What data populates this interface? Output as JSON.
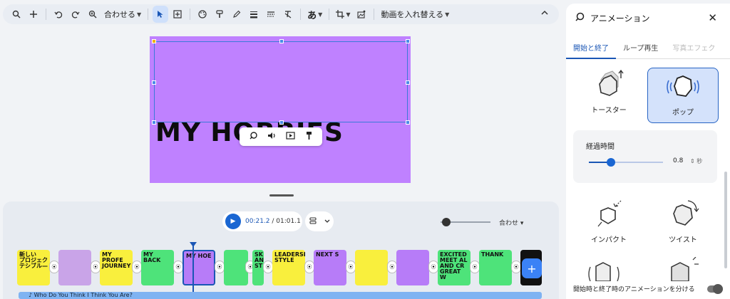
{
  "toolbar": {
    "fit_label": "合わせる",
    "font_glyph": "あ",
    "replace_video_label": "動画を入れ替える",
    "icons": [
      "search-icon",
      "plus-icon",
      "undo-icon",
      "redo-icon",
      "zoom-icon",
      "select-arrow-icon",
      "add-textbox-icon",
      "palette-icon",
      "paint-format-icon",
      "pen-icon",
      "line-weight-icon",
      "line-dash-icon",
      "clear-format-icon",
      "font-icon",
      "crop-icon",
      "image-options-icon",
      "chevron-up-icon"
    ]
  },
  "slide": {
    "title": "MY HOBBIES",
    "background": "#bf81ff"
  },
  "timeline": {
    "current_time": "00:21.2",
    "total_time": "01:01.1",
    "fit_label": "合わせ",
    "audio_track": "Who Do You Think I Think You Are?",
    "thumbnails": [
      {
        "text": "新しい\nプロジェク\nテシブル—",
        "bg": "#f9ef3d",
        "color": "#111"
      },
      {
        "text": "",
        "bg": "#c9a4e8",
        "color": "#111"
      },
      {
        "text": "MY PROFE\nJOURNEY",
        "bg": "#f9ef3d",
        "color": "#111"
      },
      {
        "text": "MY BACK",
        "bg": "#4ee37a",
        "color": "#111"
      },
      {
        "text": "MY HOE",
        "bg": "#b77cf8",
        "color": "#111"
      },
      {
        "text": "",
        "bg": "#4ee37a",
        "color": "#111"
      },
      {
        "text": "SK\nAN\nST",
        "bg": "#4ee37a",
        "color": "#111"
      },
      {
        "text": "LEADERSHIP\nSTYLE",
        "bg": "#f9ef3d",
        "color": "#111"
      },
      {
        "text": "NEXT S",
        "bg": "#b77cf8",
        "color": "#111"
      },
      {
        "text": "",
        "bg": "#f9ef3d",
        "color": "#111"
      },
      {
        "text": "",
        "bg": "#b77cf8",
        "color": "#111"
      },
      {
        "text": "EXCITED\nMEET AL\nAND CR\nGREAT W",
        "bg": "#4ee37a",
        "color": "#111"
      },
      {
        "text": "THANK",
        "bg": "#4ee37a",
        "color": "#111"
      },
      {
        "text": "",
        "bg": "#111111",
        "color": "#fff"
      }
    ]
  },
  "panel": {
    "title": "アニメーション",
    "tabs": [
      "開始と終了",
      "ループ再生",
      "写真エフェク"
    ],
    "animations": [
      {
        "label": "トースター",
        "selected": false
      },
      {
        "label": "ポップ",
        "selected": true
      },
      {
        "label": "インパクト",
        "selected": false
      },
      {
        "label": "ツイスト",
        "selected": false
      }
    ],
    "duration_label": "経過時間",
    "duration_value": "0.8",
    "duration_unit": "秒",
    "duration_fraction": 0.3,
    "footer_text": "開始時と終了時のアニメーションを分ける"
  }
}
